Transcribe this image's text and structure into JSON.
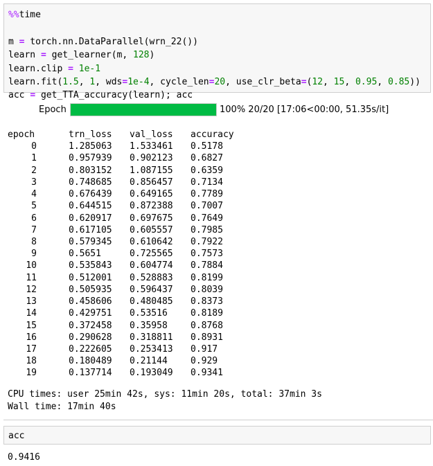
{
  "cell1": {
    "lines": [
      [
        {
          "t": "%%",
          "c": "magic-pct"
        },
        {
          "t": "time",
          "c": ""
        }
      ],
      [],
      [
        {
          "t": "m ",
          "c": ""
        },
        {
          "t": "=",
          "c": "op"
        },
        {
          "t": " torch.nn.DataParallel(wrn_22())",
          "c": ""
        }
      ],
      [
        {
          "t": "learn ",
          "c": ""
        },
        {
          "t": "=",
          "c": "op"
        },
        {
          "t": " get_learner(m, ",
          "c": ""
        },
        {
          "t": "128",
          "c": "num"
        },
        {
          "t": ")",
          "c": ""
        }
      ],
      [
        {
          "t": "learn.clip ",
          "c": ""
        },
        {
          "t": "=",
          "c": "op"
        },
        {
          "t": " ",
          "c": ""
        },
        {
          "t": "1e-1",
          "c": "num"
        }
      ],
      [
        {
          "t": "learn.fit(",
          "c": ""
        },
        {
          "t": "1.5",
          "c": "num"
        },
        {
          "t": ", ",
          "c": ""
        },
        {
          "t": "1",
          "c": "num"
        },
        {
          "t": ", wds",
          "c": ""
        },
        {
          "t": "=",
          "c": "op"
        },
        {
          "t": "1e-4",
          "c": "num"
        },
        {
          "t": ", cycle_len",
          "c": ""
        },
        {
          "t": "=",
          "c": "op"
        },
        {
          "t": "20",
          "c": "num"
        },
        {
          "t": ", use_clr_beta",
          "c": ""
        },
        {
          "t": "=",
          "c": "op"
        },
        {
          "t": "(",
          "c": ""
        },
        {
          "t": "12",
          "c": "num"
        },
        {
          "t": ", ",
          "c": ""
        },
        {
          "t": "15",
          "c": "num"
        },
        {
          "t": ", ",
          "c": ""
        },
        {
          "t": "0.95",
          "c": "num"
        },
        {
          "t": ", ",
          "c": ""
        },
        {
          "t": "0.85",
          "c": "num"
        },
        {
          "t": "))",
          "c": ""
        }
      ],
      [
        {
          "t": "acc ",
          "c": ""
        },
        {
          "t": "=",
          "c": "op"
        },
        {
          "t": " get_TTA_accuracy(learn); acc",
          "c": ""
        }
      ]
    ]
  },
  "progress": {
    "label": "Epoch",
    "fraction": 1.0,
    "fill_color": "#00bb44",
    "status_text": "100% 20/20 [17:06<00:00, 51.35s/it]"
  },
  "table": {
    "headers": [
      "epoch",
      "trn_loss",
      "val_loss",
      "accuracy"
    ],
    "rows": [
      [
        "0",
        "1.285063",
        "1.533461",
        "0.5178"
      ],
      [
        "1",
        "0.957939",
        "0.902123",
        "0.6827"
      ],
      [
        "2",
        "0.803152",
        "1.087155",
        "0.6359"
      ],
      [
        "3",
        "0.748685",
        "0.856457",
        "0.7134"
      ],
      [
        "4",
        "0.676439",
        "0.649165",
        "0.7789"
      ],
      [
        "5",
        "0.644515",
        "0.872388",
        "0.7007"
      ],
      [
        "6",
        "0.620917",
        "0.697675",
        "0.7649"
      ],
      [
        "7",
        "0.617105",
        "0.605557",
        "0.7985"
      ],
      [
        "8",
        "0.579345",
        "0.610642",
        "0.7922"
      ],
      [
        "9",
        "0.5651",
        "0.725565",
        "0.7573"
      ],
      [
        "10",
        "0.535843",
        "0.604774",
        "0.7884"
      ],
      [
        "11",
        "0.512001",
        "0.528883",
        "0.8199"
      ],
      [
        "12",
        "0.505935",
        "0.596437",
        "0.8039"
      ],
      [
        "13",
        "0.458606",
        "0.480485",
        "0.8373"
      ],
      [
        "14",
        "0.429751",
        "0.53516",
        "0.8189"
      ],
      [
        "15",
        "0.372458",
        "0.35958",
        "0.8768"
      ],
      [
        "16",
        "0.290628",
        "0.318811",
        "0.8931"
      ],
      [
        "17",
        "0.222605",
        "0.253413",
        "0.917"
      ],
      [
        "18",
        "0.180489",
        "0.21144",
        "0.929"
      ],
      [
        "19",
        "0.137714",
        "0.193049",
        "0.9341"
      ]
    ]
  },
  "timing": {
    "cpu": "CPU times: user 25min 42s, sys: 11min 20s, total: 37min 3s",
    "wall": "Wall time: 17min 40s"
  },
  "cell2": {
    "code": "acc"
  },
  "result": {
    "value": "0.9416"
  }
}
